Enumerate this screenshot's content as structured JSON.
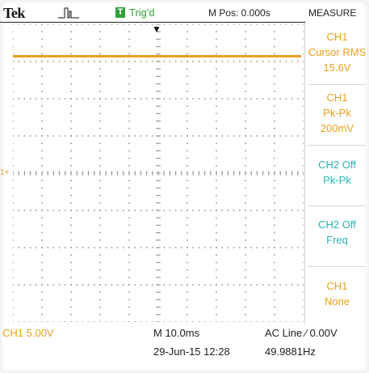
{
  "header": {
    "brand": "Tek",
    "acquire_icon": "pulse-waveform-icon",
    "trigger_badge": "T",
    "trigger_status": "Trig'd",
    "position": "M Pos: 0.000s",
    "menu_title": "MEASURE"
  },
  "display": {
    "trigger_marker": "▼",
    "ch1_marker": "1+",
    "trace_color": "#e8a020",
    "grid_divisions": {
      "horizontal": 10,
      "vertical": 8
    }
  },
  "measurements": [
    {
      "source": "CH1",
      "type": "Cursor RMS",
      "value": "15.6V"
    },
    {
      "source": "CH1",
      "type": "Pk-Pk",
      "value": "200mV"
    },
    {
      "source": "CH2 Off",
      "type": "Pk-Pk",
      "value": ""
    },
    {
      "source": "CH2 Off",
      "type": "Freq",
      "value": ""
    },
    {
      "source": "CH1",
      "type": "None",
      "value": ""
    }
  ],
  "footer": {
    "ch1_scale": "CH1  5.00V",
    "timebase": "M 10.0ms",
    "datetime": "29-Jun-15 12:28",
    "trigger_source": "AC Line ⁄ 0.00V",
    "frequency": "49.9881Hz"
  },
  "colors": {
    "ch1": "#e8a020",
    "ch2": "#2ab3b3",
    "trig": "#2fa23a"
  }
}
